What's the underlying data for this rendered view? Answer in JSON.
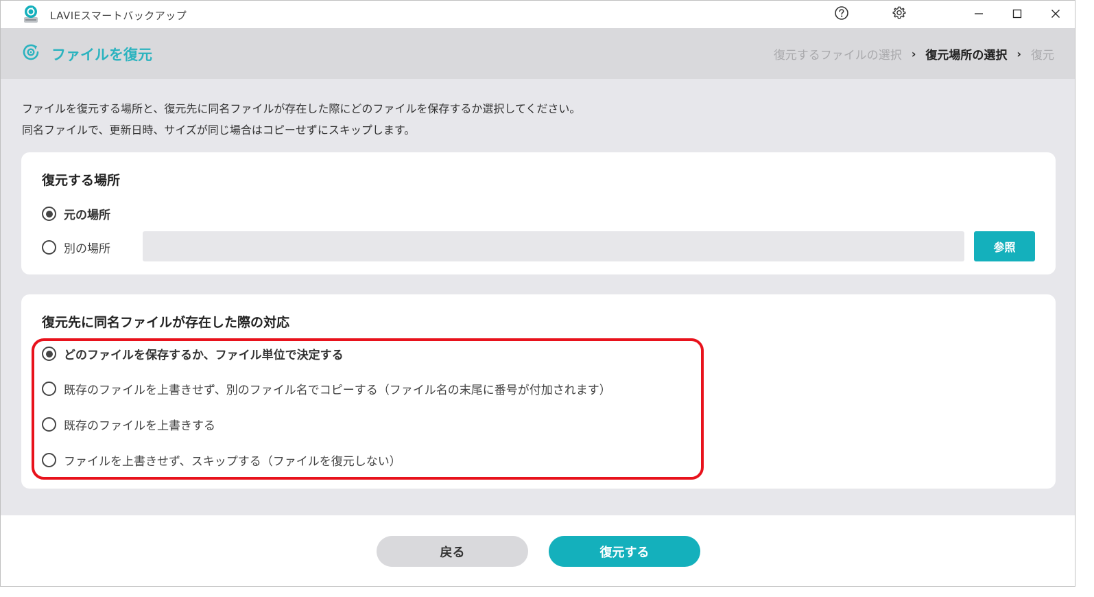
{
  "window": {
    "app_title": "LAVIEスマートバックアップ",
    "app_icon": "backup-app-icon",
    "controls": [
      "help-icon",
      "gear-icon",
      "minimize-icon",
      "maximize-icon",
      "close-icon"
    ]
  },
  "header": {
    "title": "ファイルを復元",
    "icon": "restore-icon",
    "breadcrumb": [
      {
        "label": "復元するファイルの選択",
        "state": "done"
      },
      {
        "label": "復元場所の選択",
        "state": "active"
      },
      {
        "label": "復元",
        "state": "pending"
      }
    ],
    "breadcrumb_separator": "›"
  },
  "intro": {
    "line1": "ファイルを復元する場所と、復元先に同名ファイルが存在した際にどのファイルを保存するか選択してください。",
    "line2": "同名ファイルで、更新日時、サイズが同じ場合はコピーせずにスキップします。"
  },
  "location": {
    "title": "復元する場所",
    "options": [
      {
        "label": "元の場所",
        "checked": true
      },
      {
        "label": "別の場所",
        "checked": false
      }
    ],
    "path_value": "",
    "browse_label": "参照"
  },
  "duplicate": {
    "title": "復元先に同名ファイルが存在した際の対応",
    "options": [
      {
        "label": "どのファイルを保存するか、ファイル単位で決定する",
        "checked": true
      },
      {
        "label": "既存のファイルを上書きせず、別のファイル名でコピーする（ファイル名の末尾に番号が付加されます）",
        "checked": false
      },
      {
        "label": "既存のファイルを上書きする",
        "checked": false
      },
      {
        "label": "ファイルを上書きせず、スキップする（ファイルを復元しない）",
        "checked": false
      }
    ]
  },
  "footer": {
    "back_label": "戻る",
    "restore_label": "復元する"
  },
  "colors": {
    "accent": "#14b0bc",
    "header_bg": "#d9d9dc",
    "main_bg": "#e7e7eb",
    "highlight": "#e8121c",
    "breadcrumb_inactive": "#a9a9ac"
  }
}
